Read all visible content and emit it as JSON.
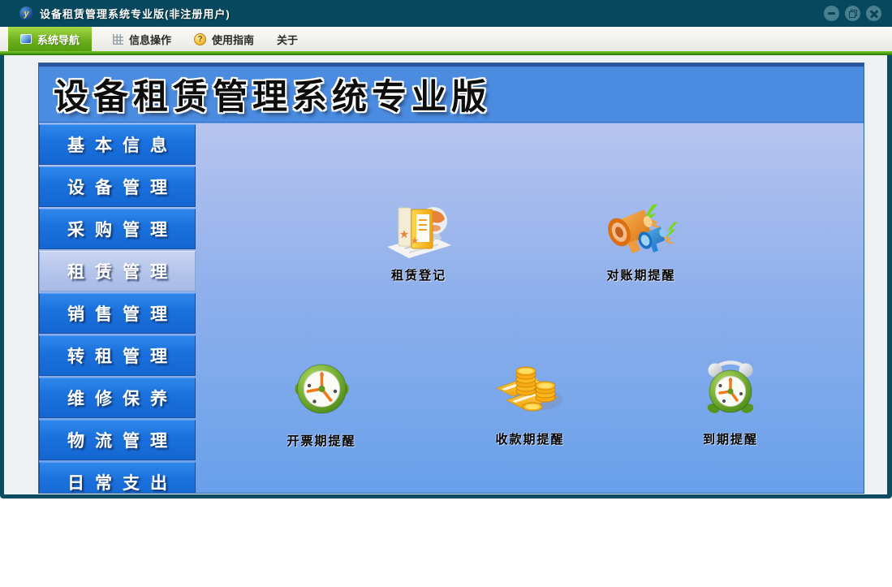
{
  "window": {
    "title": "设备租赁管理系统专业版(非注册用户)",
    "app_icon_letter": "y",
    "controls": [
      "minimize",
      "restore",
      "close"
    ]
  },
  "menubar": {
    "items": [
      {
        "label": "系统导航",
        "icon": "window-icon",
        "active": true
      },
      {
        "label": "信息操作",
        "icon": "grid-icon",
        "active": false
      },
      {
        "label": "使用指南",
        "icon": "help-coin-icon",
        "active": false
      },
      {
        "label": "关于",
        "icon": null,
        "active": false
      }
    ]
  },
  "banner": {
    "title": "设备租赁管理系统专业版"
  },
  "sidebar": {
    "items": [
      {
        "label": "基本信息",
        "active": false
      },
      {
        "label": "设备管理",
        "active": false
      },
      {
        "label": "采购管理",
        "active": false
      },
      {
        "label": "租赁管理",
        "active": true
      },
      {
        "label": "销售管理",
        "active": false
      },
      {
        "label": "转租管理",
        "active": false
      },
      {
        "label": "维修保养",
        "active": false
      },
      {
        "label": "物流管理",
        "active": false
      },
      {
        "label": "日常支出",
        "active": false
      }
    ]
  },
  "main": {
    "shortcuts": [
      {
        "label": "租赁登记",
        "icon": "books-globe-icon"
      },
      {
        "label": "对账期提醒",
        "icon": "megaphones-icon"
      },
      {
        "label": "开票期提醒",
        "icon": "stopwatch-icon"
      },
      {
        "label": "收款期提醒",
        "icon": "gold-coins-icon"
      },
      {
        "label": "到期提醒",
        "icon": "alarm-clock-icon"
      }
    ]
  },
  "colors": {
    "titlebar": "#07485e",
    "frame": "#0b4c62",
    "accent_green": "#5aa614",
    "nav_button_blue": "#1a70dc",
    "nav_selected": "#b2c3ea",
    "banner_blue": "#4b8be0",
    "content_gradient_top": "#b7c4ee",
    "content_gradient_bottom": "#68a0ea"
  }
}
